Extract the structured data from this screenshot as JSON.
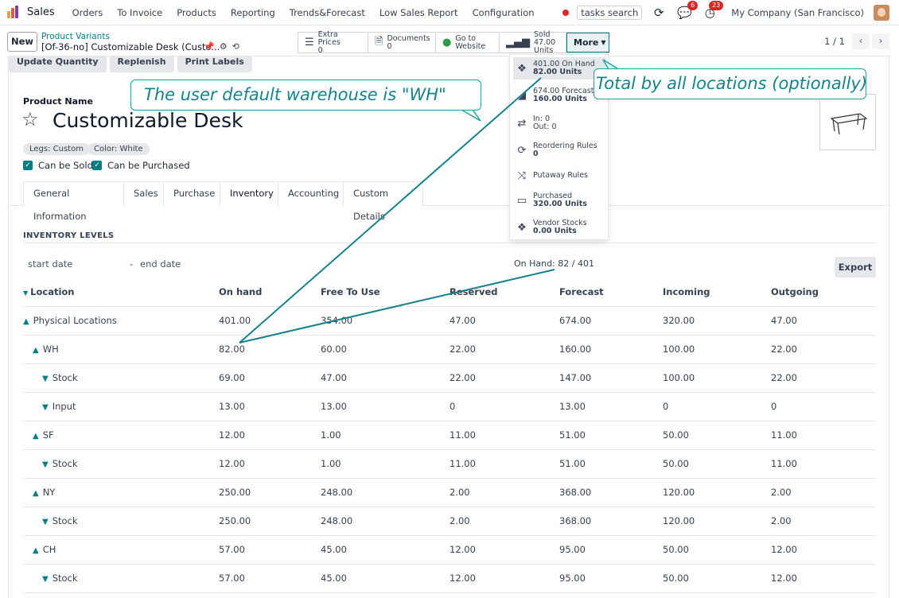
{
  "navbar": {
    "app": "Sales",
    "menu": [
      "Orders",
      "To Invoice",
      "Products",
      "Reporting",
      "Trends&Forecast",
      "Low Sales Report",
      "Configuration"
    ],
    "search_placeholder": "tasks search",
    "messages_badge": "6",
    "activities_badge": "23",
    "company": "My Company (San Francisco)"
  },
  "control": {
    "new_label": "New",
    "breadcrumb_parent": "Product Variants",
    "breadcrumb_current": "[Of-36-no] Customizable Desk (Custo...",
    "smart_buttons": [
      {
        "icon": "list-icon",
        "label": "Extra Prices",
        "value": "0"
      },
      {
        "icon": "document-icon",
        "label": "Documents",
        "value": "0"
      },
      {
        "icon": "globe-icon",
        "label": "Go to",
        "value": "Website"
      },
      {
        "icon": "chart-icon",
        "label": "Sold",
        "value": "47.00 Units"
      }
    ],
    "more_label": "More",
    "pager": "1 / 1"
  },
  "dropdown": [
    {
      "icon": "cubes-icon",
      "line1": "401.00 On Hand",
      "line2": "82.00 Units"
    },
    {
      "icon": "area-chart-icon",
      "line1": "674.00 Forecasted",
      "line2": "160.00 Units"
    },
    {
      "icon": "arrows-icon",
      "line1": "In: 0",
      "line2": "Out: 0"
    },
    {
      "icon": "refresh-icon",
      "line1": "Reordering Rules",
      "line2": "0"
    },
    {
      "icon": "random-icon",
      "line1": "Putaway Rules",
      "line2": ""
    },
    {
      "icon": "credit-card-icon",
      "line1": "Purchased",
      "line2": "320.00 Units"
    },
    {
      "icon": "cubes-icon",
      "line1": "Vendor Stocks",
      "line2": "0.00 Units"
    }
  ],
  "form": {
    "actions": [
      "Update Quantity",
      "Replenish",
      "Print Labels"
    ],
    "product_name_label": "Product Name",
    "product_name": "Customizable Desk",
    "tags": [
      "Legs: Custom",
      "Color: White"
    ],
    "can_be_sold": "Can be Sold",
    "can_be_purchased": "Can be Purchased",
    "tabs": [
      "General Information",
      "Sales",
      "Purchase",
      "Inventory",
      "Accounting",
      "Custom Details"
    ],
    "active_tab": "Inventory"
  },
  "inventory": {
    "title": "INVENTORY LEVELS",
    "start_date": "start date",
    "dash": "-",
    "end_date": "end date",
    "on_hand_summary": "On Hand: 82 / 401",
    "export_label": "Export",
    "columns": [
      "Location",
      "On hand",
      "Free To Use",
      "Reserved",
      "Forecast",
      "Incoming",
      "Outgoing"
    ],
    "rows": [
      {
        "level": 0,
        "caret": "up",
        "location": "Physical Locations",
        "values": [
          "401.00",
          "354.00",
          "47.00",
          "674.00",
          "320.00",
          "47.00"
        ]
      },
      {
        "level": 1,
        "caret": "up",
        "location": "WH",
        "values": [
          "82.00",
          "60.00",
          "22.00",
          "160.00",
          "100.00",
          "22.00"
        ]
      },
      {
        "level": 2,
        "caret": "down",
        "location": "Stock",
        "values": [
          "69.00",
          "47.00",
          "22.00",
          "147.00",
          "100.00",
          "22.00"
        ]
      },
      {
        "level": 2,
        "caret": "down",
        "location": "Input",
        "values": [
          "13.00",
          "13.00",
          "0",
          "13.00",
          "0",
          "0"
        ]
      },
      {
        "level": 1,
        "caret": "up",
        "location": "SF",
        "values": [
          "12.00",
          "1.00",
          "11.00",
          "51.00",
          "50.00",
          "11.00"
        ]
      },
      {
        "level": 2,
        "caret": "down",
        "location": "Stock",
        "values": [
          "12.00",
          "1.00",
          "11.00",
          "51.00",
          "50.00",
          "11.00"
        ]
      },
      {
        "level": 1,
        "caret": "up",
        "location": "NY",
        "values": [
          "250.00",
          "248.00",
          "2.00",
          "368.00",
          "120.00",
          "2.00"
        ]
      },
      {
        "level": 2,
        "caret": "down",
        "location": "Stock",
        "values": [
          "250.00",
          "248.00",
          "2.00",
          "368.00",
          "120.00",
          "2.00"
        ]
      },
      {
        "level": 1,
        "caret": "up",
        "location": "CH",
        "values": [
          "57.00",
          "45.00",
          "12.00",
          "95.00",
          "50.00",
          "12.00"
        ]
      },
      {
        "level": 2,
        "caret": "down",
        "location": "Stock",
        "values": [
          "57.00",
          "45.00",
          "12.00",
          "95.00",
          "50.00",
          "12.00"
        ]
      }
    ]
  },
  "annotations": {
    "warehouse_note": "The user default warehouse is \"WH\"",
    "total_note": "Total by all locations (optionally)"
  },
  "colors": {
    "accent": "#017e84",
    "callout": "#17828a",
    "badge": "#dc2626"
  }
}
